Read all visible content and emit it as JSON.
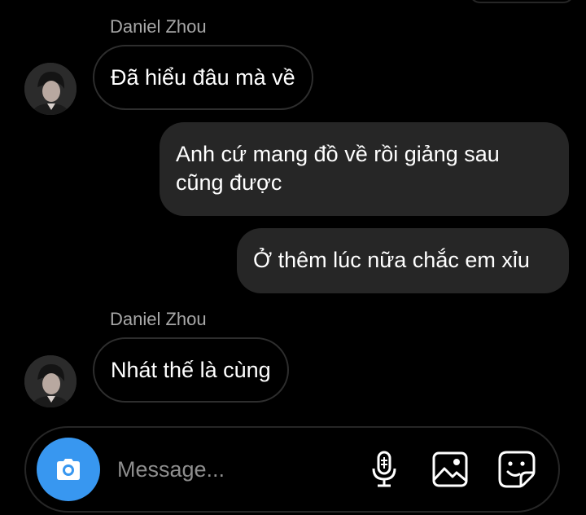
{
  "thread": {
    "messages": [
      {
        "direction": "incoming",
        "sender": "Daniel Zhou",
        "text": "Đã hiểu đâu mà về"
      },
      {
        "direction": "outgoing",
        "lines": [
          "Anh cứ mang đồ về rồi giảng sau",
          "cũng được"
        ]
      },
      {
        "direction": "outgoing",
        "text": "Ở thêm lúc nữa chắc em xỉu"
      },
      {
        "direction": "incoming",
        "sender": "Daniel Zhou",
        "text": "Nhát thế là cùng"
      }
    ]
  },
  "composer": {
    "placeholder": "Message...",
    "camera_icon": "camera-icon",
    "mic_icon": "microphone-icon",
    "gallery_icon": "image-icon",
    "sticker_icon": "sticker-icon"
  },
  "colors": {
    "background": "#000000",
    "incoming_border": "#2e2e2e",
    "outgoing_bubble": "#262626",
    "sender_name": "#a8a8a8",
    "camera_button": "#3897f0",
    "placeholder": "#8e8e8e"
  }
}
